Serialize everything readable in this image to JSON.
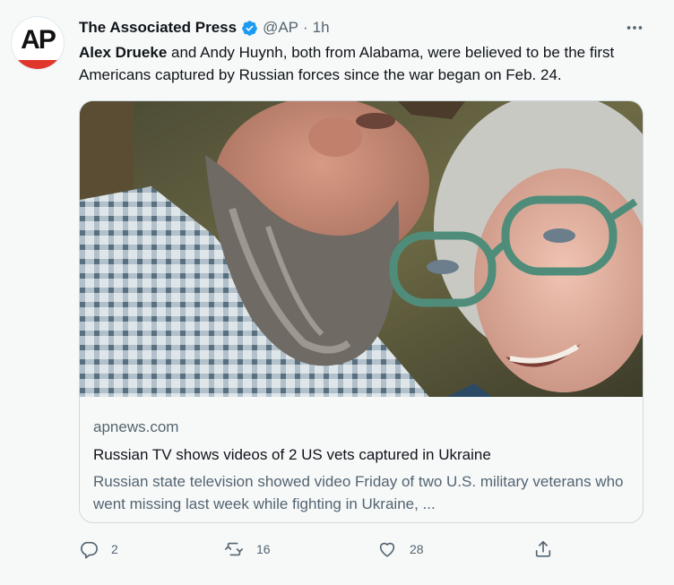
{
  "tweet": {
    "author_name": "The Associated Press",
    "handle": "@AP",
    "separator": "·",
    "time": "1h",
    "avatar_text": "AP",
    "text_bold": "Alex Drueke",
    "text_rest": " and Andy Huynh, both from Alabama, were believed to be the first Americans captured by Russian forces since the war began on Feb. 24."
  },
  "card": {
    "domain": "apnews.com",
    "title": "Russian TV shows videos of 2 US vets captured in Ukraine",
    "description": "Russian state television showed video Friday of two U.S. military veterans who went missing last week while fighting in Ukraine, ..."
  },
  "actions": {
    "reply_count": "2",
    "retweet_count": "16",
    "like_count": "28"
  },
  "icons": {
    "verified": "verified-badge-icon",
    "more": "more-icon",
    "reply": "reply-icon",
    "retweet": "retweet-icon",
    "like": "like-icon",
    "share": "share-icon"
  },
  "colors": {
    "background": "#f7f9f9",
    "text_primary": "#0f1419",
    "text_secondary": "#536471",
    "verified_blue": "#1d9bf0",
    "ap_red": "#e0362c",
    "border": "#cfd9de"
  }
}
